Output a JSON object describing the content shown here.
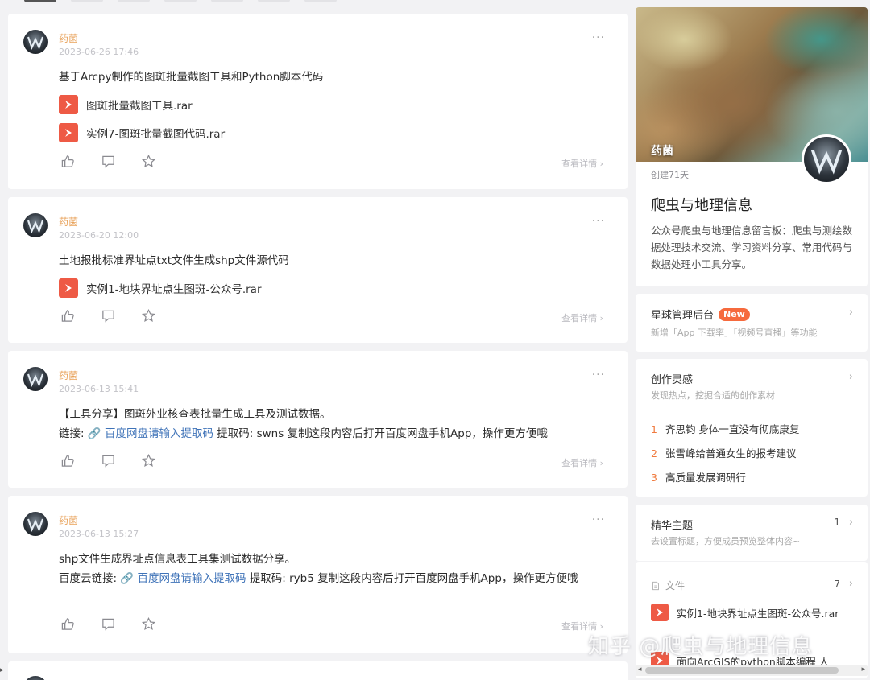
{
  "feed": {
    "posts": [
      {
        "author": "药菌",
        "time": "2023-06-26 17:46",
        "text": "基于Arcpy制作的图斑批量截图工具和Python脚本代码",
        "files": [
          "图斑批量截图工具.rar",
          "实例7-图斑批量截图代码.rar"
        ],
        "detail": "查看详情 ›"
      },
      {
        "author": "药菌",
        "time": "2023-06-20 12:00",
        "text": "土地报批标准界址点txt文件生成shp文件源代码",
        "files": [
          "实例1-地块界址点生图斑-公众号.rar"
        ],
        "detail": "查看详情 ›"
      },
      {
        "author": "药菌",
        "time": "2023-06-13 15:41",
        "line1": "【工具分享】图斑外业核查表批量生成工具及测试数据。",
        "prefix": "链接: ",
        "link": "🔗 百度网盘请输入提取码",
        "suffix": " 提取码: swns 复制这段内容后打开百度网盘手机App，操作更方便哦",
        "detail": "查看详情 ›"
      },
      {
        "author": "药菌",
        "time": "2023-06-13 15:27",
        "line1": "shp文件生成界址点信息表工具集测试数据分享。",
        "prefix": "百度云链接: ",
        "link": "🔗 百度网盘请输入提取码",
        "suffix": " 提取码: ryb5 复制这段内容后打开百度网盘手机App，操作更方便哦",
        "detail": "查看详情 ›"
      }
    ],
    "more_glyph": "···"
  },
  "sidebar": {
    "cover_name": "药菌",
    "created": "创建71天",
    "group_title": "爬虫与地理信息",
    "group_desc": "公众号爬虫与地理信息留言板：爬虫与测绘数据处理技术交流、学习资料分享、常用代码与数据处理小工具分享。",
    "admin": {
      "title": "星球管理后台",
      "badge": "New",
      "sub": "新增「App 下载率」「视频号直播」等功能"
    },
    "inspire": {
      "title": "创作灵感",
      "sub": "发现热点，挖掘合适的创作素材",
      "items": [
        {
          "n": "1",
          "t": "齐思钧 身体一直没有彻底康复"
        },
        {
          "n": "2",
          "t": "张雪峰给普通女生的报考建议"
        },
        {
          "n": "3",
          "t": "高质量发展调研行"
        }
      ]
    },
    "essence": {
      "title": "精华主题",
      "sub": "去设置标题，方便成员预览整体内容~",
      "count": "1"
    },
    "files": {
      "title": "文件",
      "count": "7",
      "items": [
        "实例1-地块界址点生图斑-公众号.rar",
        "面向ArcGIS的python脚本编程 人"
      ]
    },
    "chevron": "›"
  },
  "watermark": "知乎 @爬虫与地理信息",
  "colors": {
    "accent_orange": "#e8a25a",
    "link_blue": "#3f73b8",
    "file_red": "#ee5a45",
    "badge_new": "#f66a3d"
  }
}
